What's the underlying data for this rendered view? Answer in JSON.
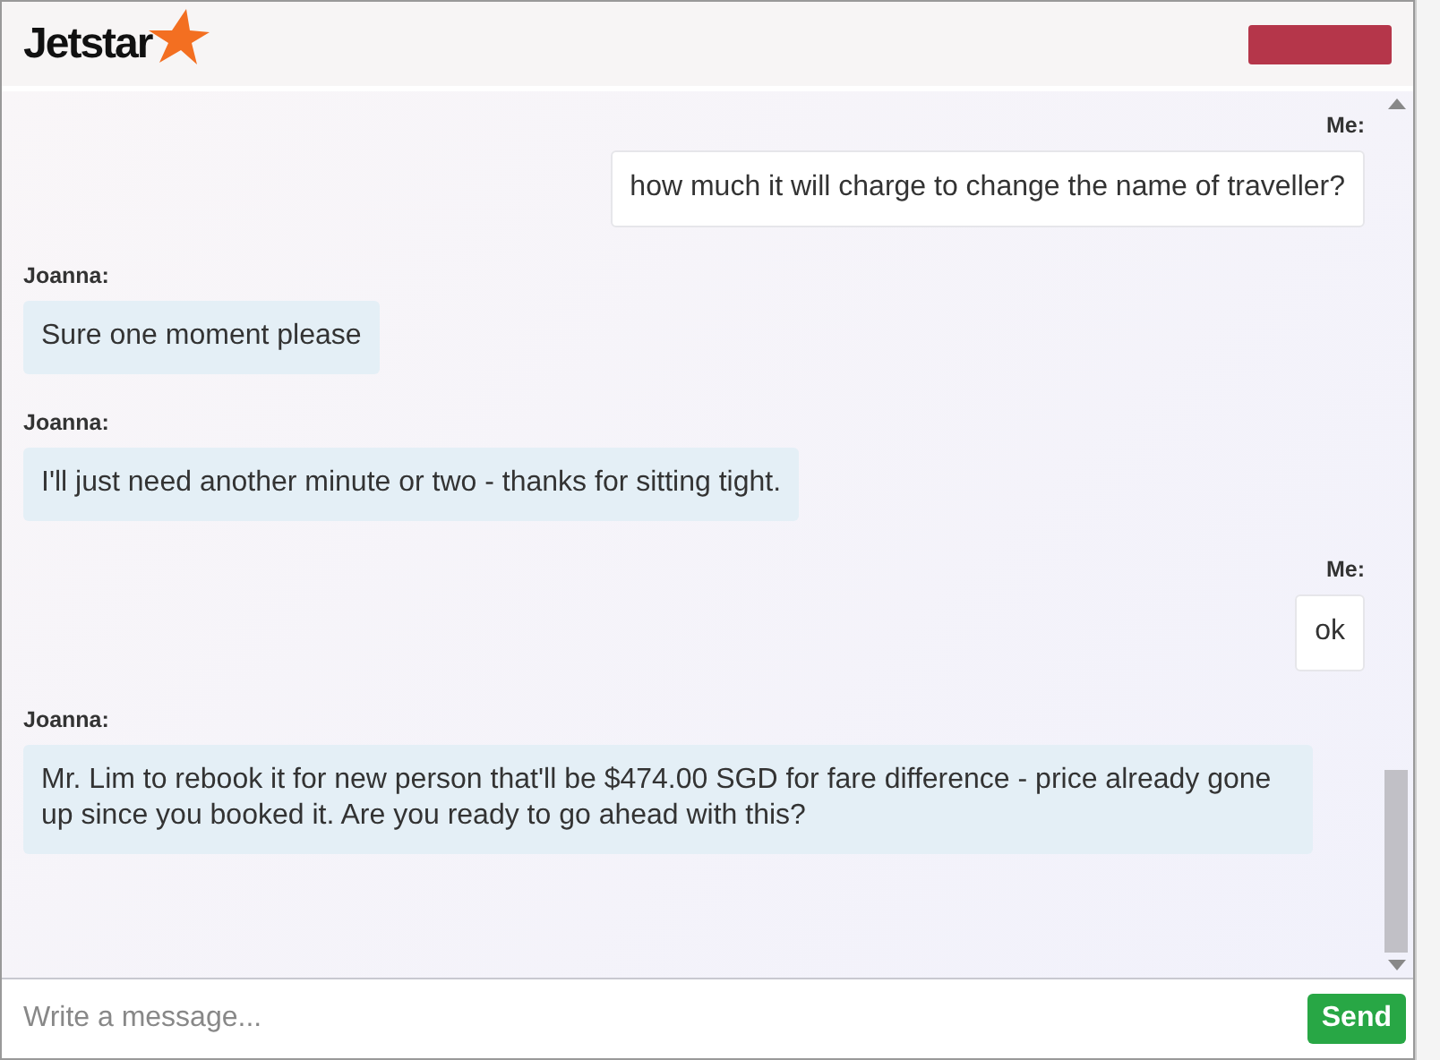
{
  "header": {
    "logo": "Jetstar"
  },
  "messages": [
    {
      "sender": "Me:",
      "kind": "me",
      "text": "how much it will charge to change the name of traveller?"
    },
    {
      "sender": "Joanna:",
      "kind": "agent",
      "text": "Sure one moment please"
    },
    {
      "sender": "Joanna:",
      "kind": "agent",
      "text": "I'll just need another minute or two - thanks for sitting tight."
    },
    {
      "sender": "Me:",
      "kind": "me",
      "text": "ok"
    },
    {
      "sender": "Joanna:",
      "kind": "agent",
      "text": "Mr. Lim to rebook it for new person that'll be $474.00 SGD for fare difference - price already gone up since you booked it. Are you ready to go ahead with this?"
    }
  ],
  "composer": {
    "placeholder": "Write a message...",
    "send": "Send"
  }
}
